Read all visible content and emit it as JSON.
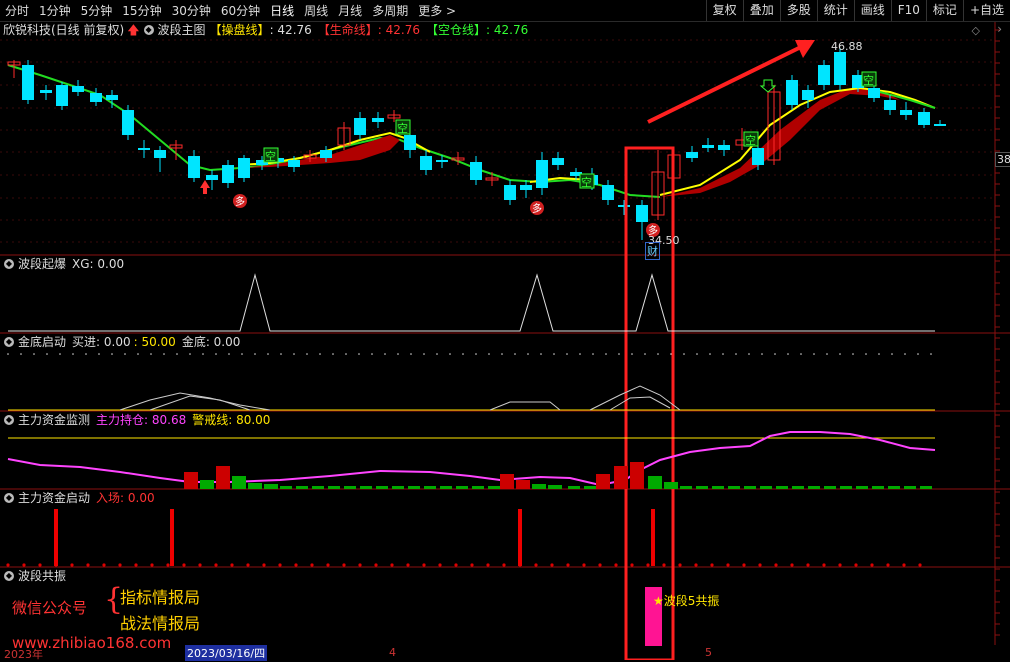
{
  "toolbar": {
    "periods": [
      "分时",
      "1分钟",
      "5分钟",
      "15分钟",
      "30分钟",
      "60分钟",
      "日线",
      "周线",
      "月线",
      "多周期",
      "更多 >"
    ],
    "active_period": "日线",
    "right_buttons": [
      "复权",
      "叠加",
      "多股",
      "统计",
      "画线",
      "F10",
      "标记",
      "+自选"
    ]
  },
  "main_panel": {
    "stock_title": "欣锐科技(日线 前复权)",
    "indicator_name": "波段主图",
    "line1_label": "【操盘线】",
    "line1_value": ": 42.76",
    "line2_label": "【生命线】",
    "line2_value": ": 42.76",
    "line3_label": "【空仓线】",
    "line3_value": ": 42.76",
    "high_label": "46.88",
    "low_label": "34.50",
    "right_price": "38",
    "cai_label": "财",
    "empty_marker": "空",
    "long_marker": "多"
  },
  "panels": {
    "p1": {
      "name": "波段起爆",
      "extra": "XG: 0.00"
    },
    "p2": {
      "name": "金底启动",
      "v1_label": "买进: 0.00",
      "v1_sep": ": 50.00",
      "v2_label": "金底: 0.00"
    },
    "p3": {
      "name": "主力资金监测",
      "v1_label": "主力持仓: 80.68",
      "v2_label": "警戒线: 80.00"
    },
    "p4": {
      "name": "主力资金启动",
      "v1_label": "入场: 0.00"
    },
    "p5": {
      "name": "波段共振",
      "resonance_label": "★波段5共振"
    }
  },
  "watermark": {
    "wechat": "微信公众号",
    "item1": "指标情报局",
    "item2": "战法情报局",
    "url": "www.zhibiao168.com"
  },
  "xaxis": {
    "year_label": "2023年",
    "date_cursor": "2023/03/16/四",
    "tick4": "4",
    "tick5": "5"
  },
  "colors": {
    "up": "#ff2a2a",
    "down": "#00e5ff",
    "highlight_box": "#ff2020",
    "magenta": "#ff44ff",
    "warn_line": "#ffe600"
  }
}
